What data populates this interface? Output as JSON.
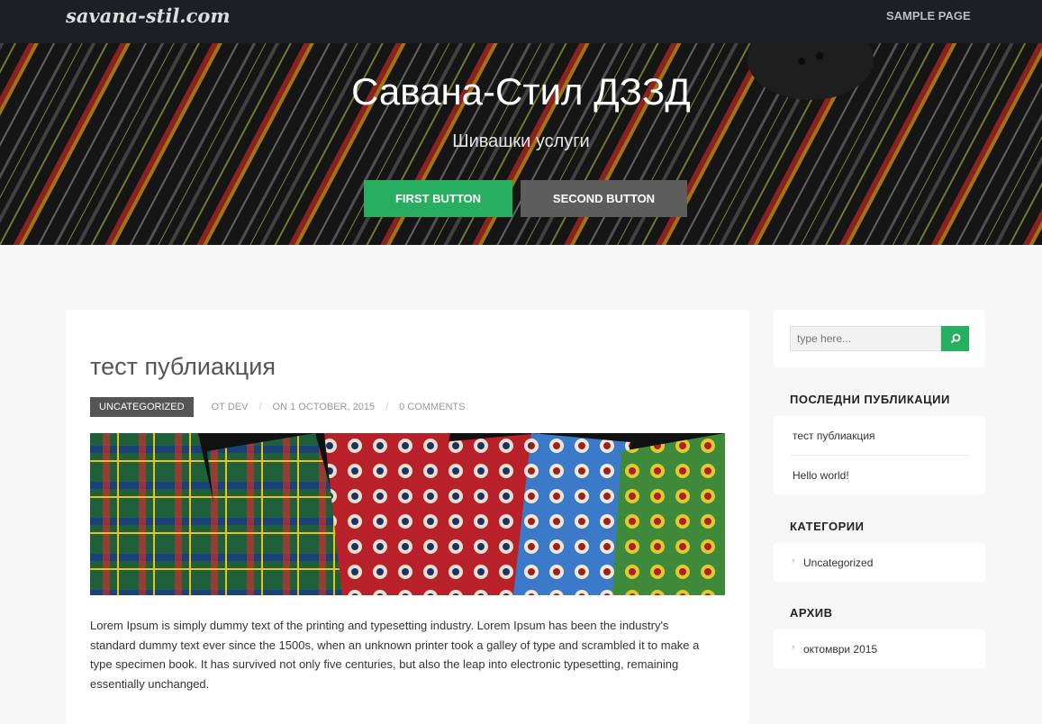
{
  "site": {
    "logo": "savana-stil.com",
    "nav": [
      {
        "label": "Sample Page"
      }
    ]
  },
  "hero": {
    "title": "Савана-Стил ДЗЗД",
    "subtitle": "Шивашки услуги",
    "first_button": "First Button",
    "second_button": "Second Button"
  },
  "post": {
    "title": "тест публиакция",
    "category": "Uncategorized",
    "author": "ОТ dev",
    "date": "on 1 October, 2015",
    "comments": "0 Comments",
    "body": "Lorem Ipsum is simply dummy text of the printing and typesetting industry. Lorem Ipsum has been the industry's standard dummy text ever since the 1500s, when an unknown printer took a galley of type and scrambled it to make a type specimen book. It has survived not only five centuries, but also the leap into electronic typesetting, remaining essentially unchanged."
  },
  "sidebar": {
    "search": {
      "placeholder": "type here..."
    },
    "recent": {
      "title": "Последни публикации",
      "items": [
        "тест публиакция",
        "Hello world!"
      ]
    },
    "categories": {
      "title": "Категории",
      "items": [
        "Uncategorized"
      ]
    },
    "archive": {
      "title": "Архив",
      "items": [
        "октомври 2015"
      ]
    }
  },
  "colors": {
    "accent": "#27ae60",
    "topbar": "#1c1f24",
    "second_button": "#5d5d5d"
  }
}
